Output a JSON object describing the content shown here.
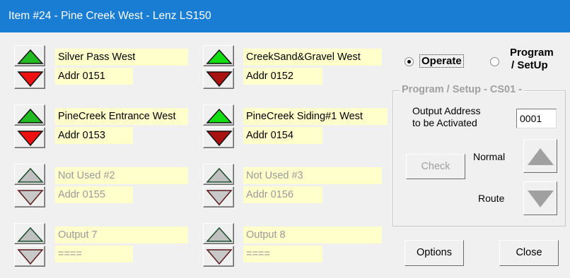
{
  "window": {
    "title": "Item #24 - Pine Creek West - Lenz LS150"
  },
  "turnouts": [
    {
      "name": "Silver Pass West",
      "addr": "Addr 0151",
      "enabled": true,
      "up_color": "#22bb22",
      "down_color": "#ee1111",
      "up_icon": "triangle-up-icon",
      "down_icon": "triangle-down-icon"
    },
    {
      "name": "CreekSand&Gravel West",
      "addr": "Addr 0152",
      "enabled": true,
      "up_color": "#11dd11",
      "down_color": "#aa1111",
      "up_icon": "triangle-up-icon",
      "down_icon": "triangle-down-icon"
    },
    {
      "name": "PineCreek Entrance West",
      "addr": "Addr 0153",
      "enabled": true,
      "up_color": "#22bb22",
      "down_color": "#ee1111",
      "up_icon": "triangle-up-icon",
      "down_icon": "triangle-down-icon"
    },
    {
      "name": "PineCreek Siding#1 West",
      "addr": "Addr 0154",
      "enabled": true,
      "up_color": "#11dd11",
      "down_color": "#aa1111",
      "up_icon": "triangle-up-icon",
      "down_icon": "triangle-down-icon"
    },
    {
      "name": "Not Used #2",
      "addr": "Addr 0155",
      "enabled": false,
      "up_icon": "triangle-up-outline-icon",
      "down_icon": "triangle-down-outline-icon"
    },
    {
      "name": "Not Used #3",
      "addr": "Addr 0156",
      "enabled": false,
      "up_icon": "triangle-up-outline-icon",
      "down_icon": "triangle-down-outline-icon"
    },
    {
      "name": "Output 7",
      "addr": "====",
      "enabled": false,
      "up_icon": "triangle-up-outline-icon",
      "down_icon": "triangle-down-outline-icon"
    },
    {
      "name": "Output 8",
      "addr": "====",
      "enabled": false,
      "up_icon": "triangle-up-outline-icon",
      "down_icon": "triangle-down-outline-icon"
    }
  ],
  "mode": {
    "operate_label": "Operate",
    "program_label_line1": "Program",
    "program_label_line2": "/ SetUp",
    "selected": "operate"
  },
  "program_group": {
    "title": "Program / Setup  -  CS01 -",
    "output_address_label_line1": "Output Address",
    "output_address_label_line2": "to be Activated",
    "output_address_value": "0001",
    "check_label": "Check",
    "normal_label": "Normal",
    "route_label": "Route"
  },
  "buttons": {
    "options_label": "Options",
    "close_label": "Close"
  },
  "colors": {
    "titlebar": "#1a7dd4",
    "label_bg": "#ffffcc"
  }
}
